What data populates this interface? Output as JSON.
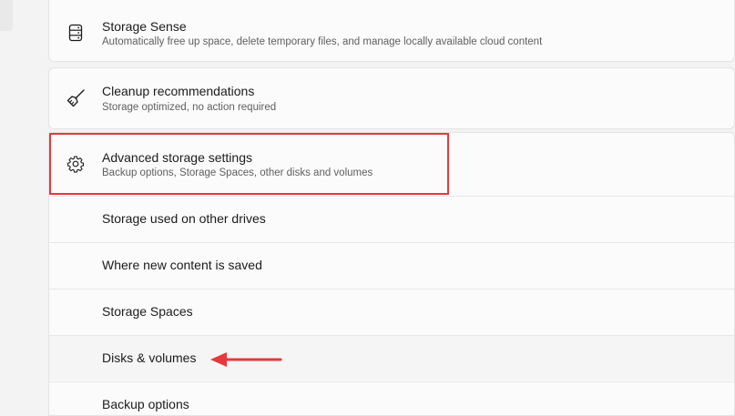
{
  "storage_sense": {
    "icon": "storage-drive-icon",
    "title": "Storage Sense",
    "description": "Automatically free up space, delete temporary files, and manage locally available cloud content"
  },
  "cleanup": {
    "icon": "broom-icon",
    "title": "Cleanup recommendations",
    "description": "Storage optimized, no action required"
  },
  "advanced": {
    "icon": "gear-icon",
    "title": "Advanced storage settings",
    "description": "Backup options, Storage Spaces, other disks and volumes",
    "items": [
      {
        "label": "Storage used on other drives"
      },
      {
        "label": "Where new content is saved"
      },
      {
        "label": "Storage Spaces"
      },
      {
        "label": "Disks & volumes"
      },
      {
        "label": "Backup options"
      }
    ]
  },
  "annotations": {
    "highlight_color": "#e5393b",
    "arrow_color": "#e5393b",
    "arrow_target": "Disks & volumes"
  }
}
